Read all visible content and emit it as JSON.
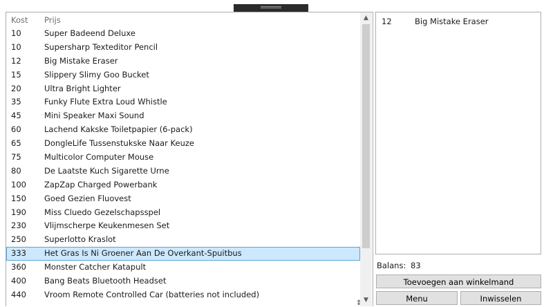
{
  "products": {
    "headers": {
      "kost": "Kost",
      "prijs": "Prijs"
    },
    "rows": [
      {
        "kost": "10",
        "naam": "Super Badeend Deluxe"
      },
      {
        "kost": "10",
        "naam": "Supersharp Texteditor Pencil"
      },
      {
        "kost": "12",
        "naam": "Big Mistake Eraser"
      },
      {
        "kost": "15",
        "naam": "Slippery Slimy Goo Bucket"
      },
      {
        "kost": "20",
        "naam": "Ultra Bright Lighter"
      },
      {
        "kost": "35",
        "naam": "Funky Flute Extra Loud Whistle"
      },
      {
        "kost": "45",
        "naam": "Mini Speaker Maxi Sound"
      },
      {
        "kost": "60",
        "naam": "Lachend Kakske Toiletpapier (6-pack)"
      },
      {
        "kost": "65",
        "naam": "DongleLife Tussenstukske Naar Keuze"
      },
      {
        "kost": "75",
        "naam": "Multicolor Computer Mouse"
      },
      {
        "kost": "80",
        "naam": "De Laatste Kuch Sigarette Urne"
      },
      {
        "kost": "100",
        "naam": "ZapZap Charged Powerbank"
      },
      {
        "kost": "150",
        "naam": "Goed Gezien Fluovest"
      },
      {
        "kost": "190",
        "naam": "Miss Cluedo Gezelschapsspel"
      },
      {
        "kost": "230",
        "naam": "Vlijmscherpe Keukenmesen Set"
      },
      {
        "kost": "250",
        "naam": "Superlotto Kraslot"
      },
      {
        "kost": "333",
        "naam": "Het Gras Is Ni Groener Aan De Overkant-Spuitbus"
      },
      {
        "kost": "360",
        "naam": "Monster Catcher Katapult"
      },
      {
        "kost": "400",
        "naam": "Bang Beats Bluetooth Headset"
      },
      {
        "kost": "440",
        "naam": "Vroom Remote Controlled Car (batteries not included)"
      }
    ],
    "selected_index": 16
  },
  "cart": {
    "rows": [
      {
        "kost": "12",
        "naam": "Big Mistake Eraser"
      }
    ]
  },
  "balans": {
    "label": "Balans:",
    "value": "83"
  },
  "buttons": {
    "add": "Toevoegen aan winkelmand",
    "menu": "Menu",
    "swap": "Inwisselen"
  },
  "icons": {
    "scroll_up": "chevron-up-icon",
    "scroll_down": "chevron-down-icon",
    "drag_handle": "grip-icon"
  }
}
